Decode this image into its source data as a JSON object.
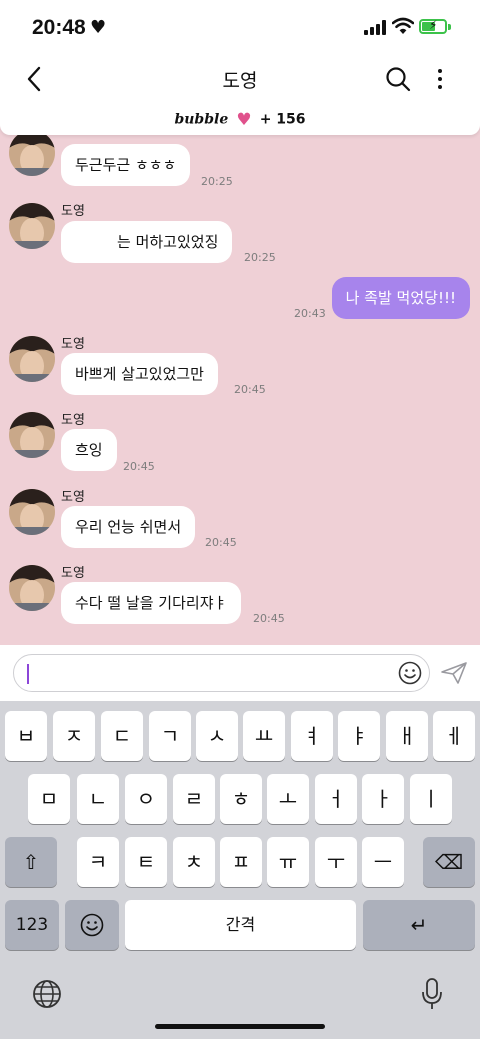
{
  "status": {
    "time": "20:48",
    "heart": "♥"
  },
  "nav": {
    "title": "도영"
  },
  "bubble_bar": {
    "brand": "bubble",
    "heart": "♥",
    "count": "+ 156"
  },
  "messages": [
    {
      "sender": "",
      "text": "두근두근 ㅎㅎㅎ",
      "time": "20:25"
    },
    {
      "sender": "도영",
      "text": "는 머하고있었징",
      "time": "20:25"
    },
    {
      "mine": "나 족발 먹었당!!!",
      "time": "20:43"
    },
    {
      "sender": "도영",
      "text": "바쁘게 살고있었그만",
      "time": "20:45"
    },
    {
      "sender": "도영",
      "text": "흐잉",
      "time": "20:45"
    },
    {
      "sender": "도영",
      "text": "우리 언능 쉬면서",
      "time": "20:45"
    },
    {
      "sender": "도영",
      "text": "수다 떨 날을 기다리쟈ㅑ",
      "time": "20:45"
    }
  ],
  "input": {
    "value": ""
  },
  "keyboard": {
    "row1": [
      "ㅂ",
      "ㅈ",
      "ㄷ",
      "ㄱ",
      "ㅅ",
      "ㅛ",
      "ㅕ",
      "ㅑ",
      "ㅐ",
      "ㅔ"
    ],
    "row2": [
      "ㅁ",
      "ㄴ",
      "ㅇ",
      "ㄹ",
      "ㅎ",
      "ㅗ",
      "ㅓ",
      "ㅏ",
      "ㅣ"
    ],
    "row3": [
      "ㅋ",
      "ㅌ",
      "ㅊ",
      "ㅍ",
      "ㅠ",
      "ㅜ",
      "ㅡ"
    ],
    "numbers_label": "123",
    "space_label": "간격",
    "return_symbol": "↵",
    "shift_symbol": "⇧",
    "delete_symbol": "⌫"
  },
  "icons": {
    "back": "chevron-left-icon",
    "search": "search-icon",
    "more": "more-vertical-icon",
    "emoji": "emoji-icon",
    "send": "send-icon",
    "globe": "globe-icon",
    "mic": "microphone-icon"
  },
  "colors": {
    "chat_background": "#efd0d6",
    "my_bubble": "#a784ec",
    "bubble_heart": "#e0518c",
    "battery": "#3cc24a",
    "keyboard_bg": "#d2d3d8",
    "input_cursor": "#8c46d8"
  }
}
